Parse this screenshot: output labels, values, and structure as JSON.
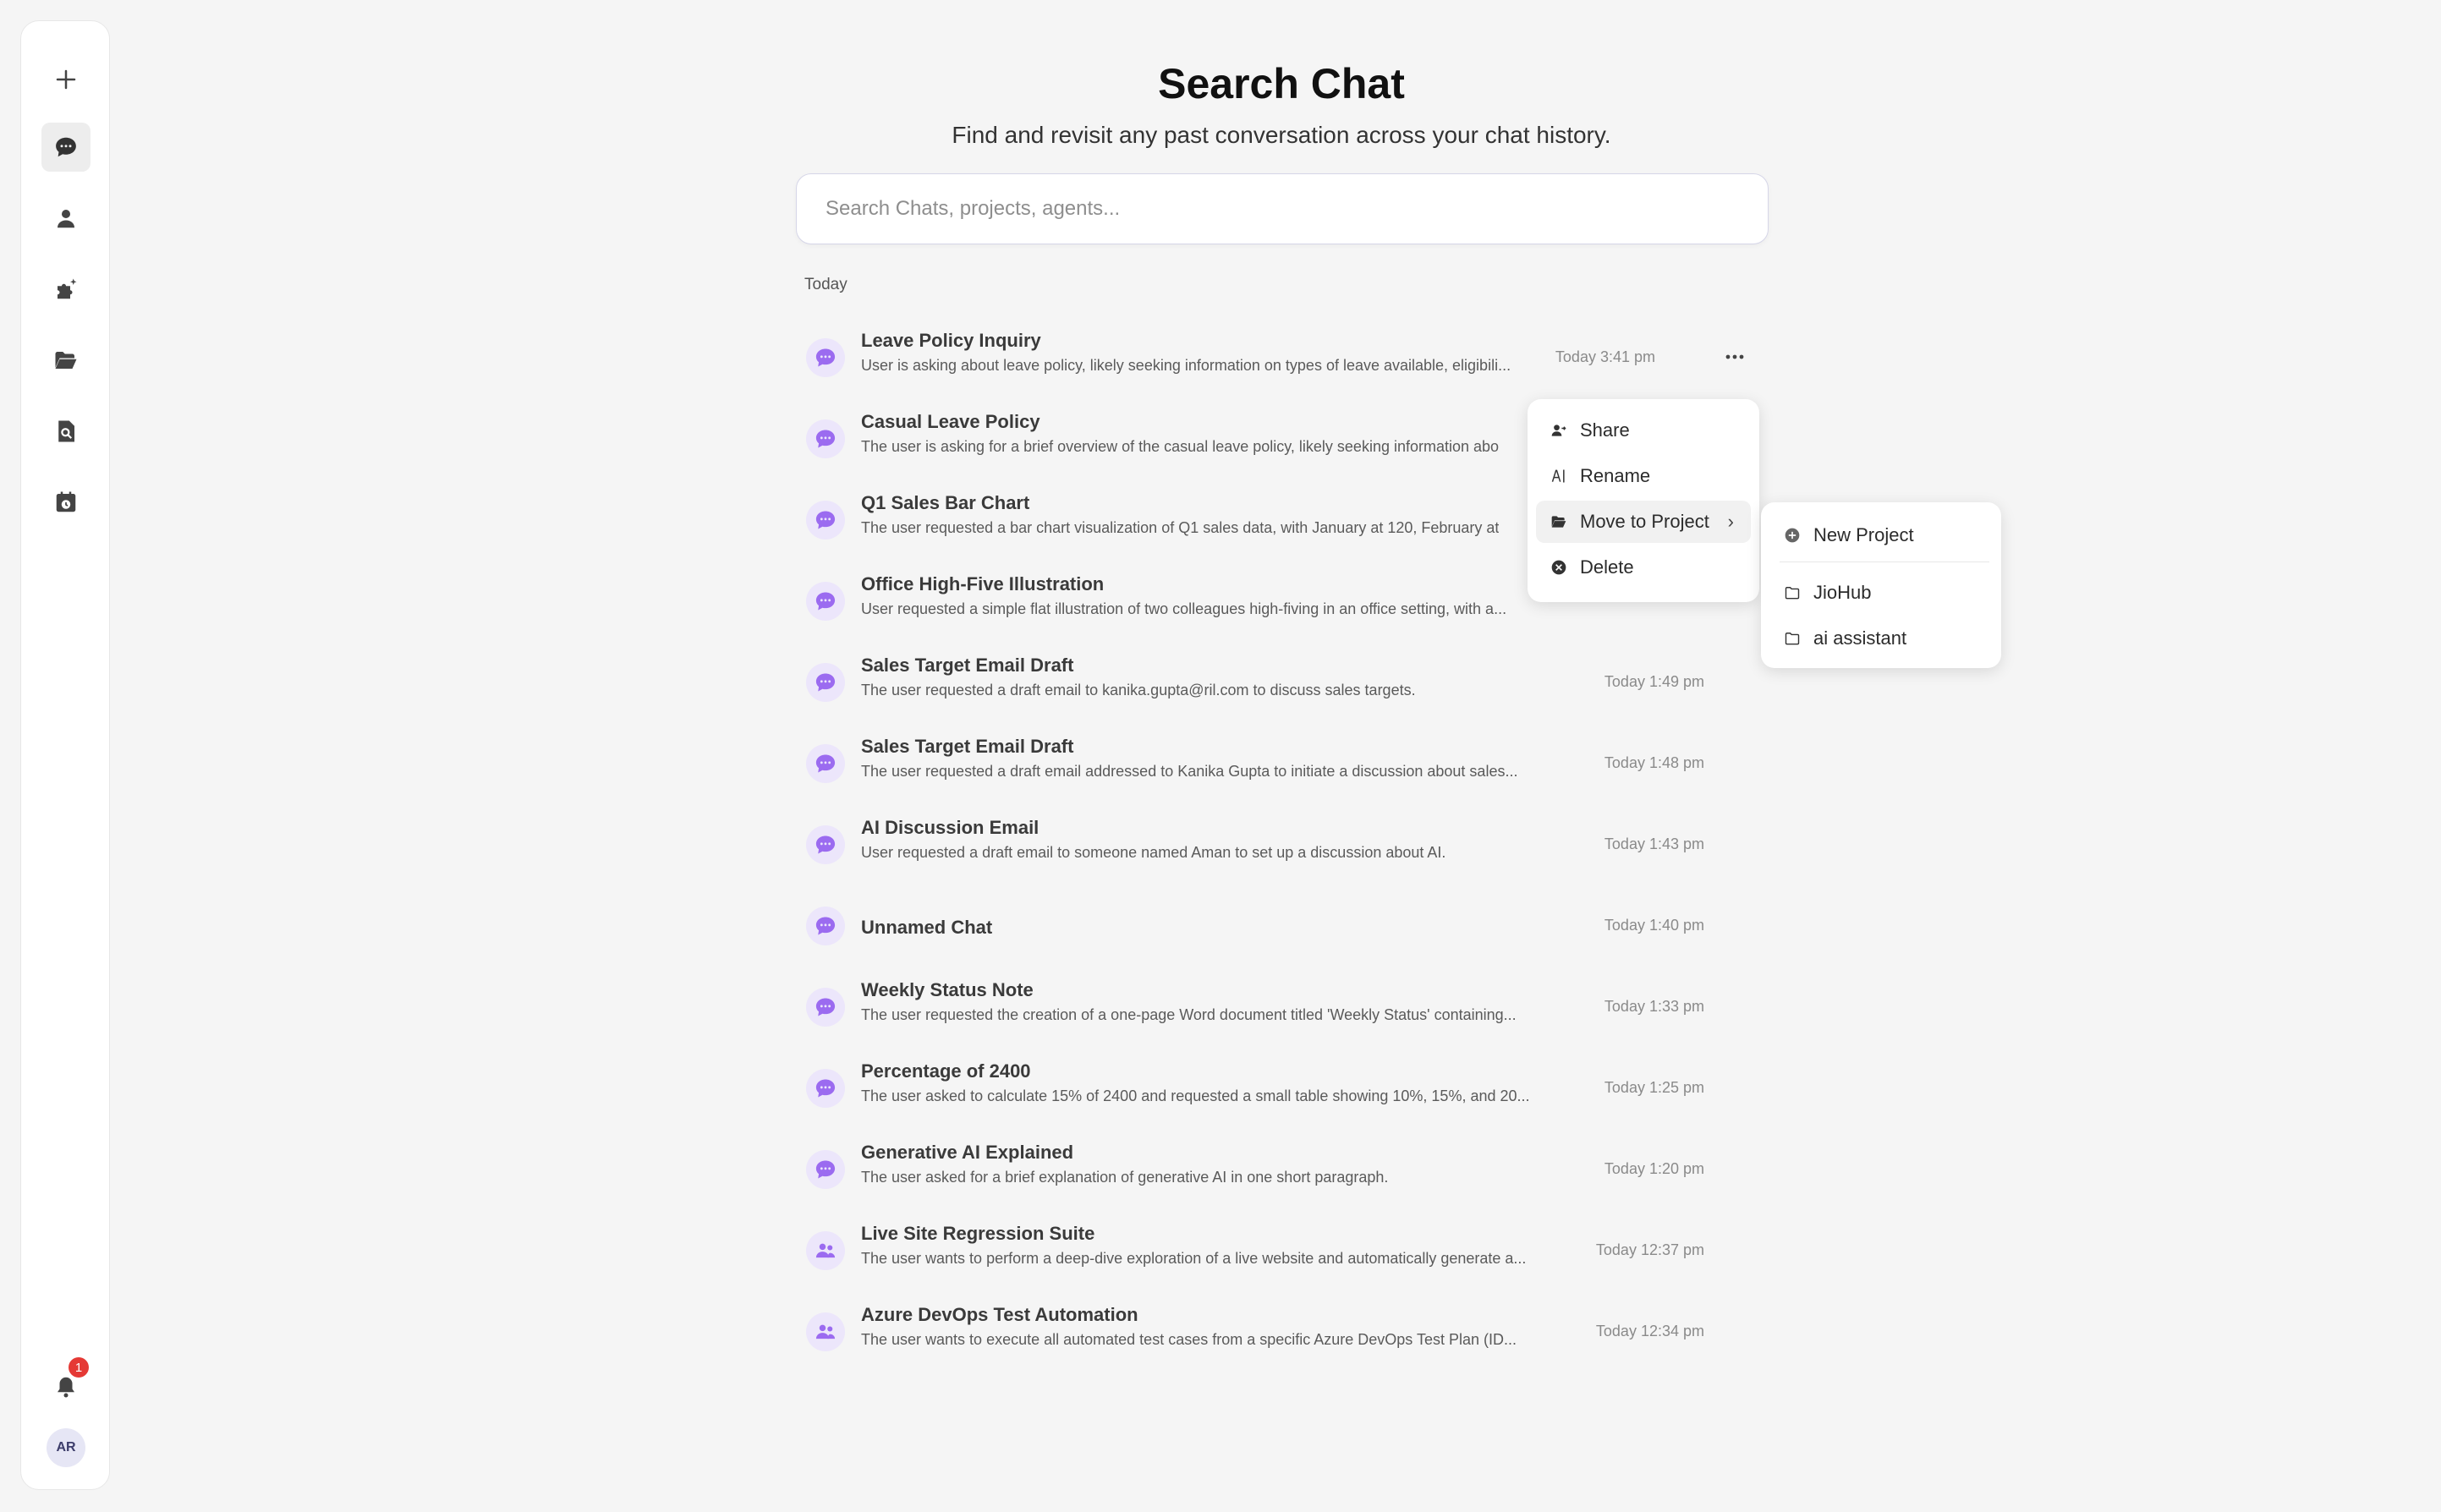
{
  "page": {
    "title": "Search Chat",
    "subtitle": "Find and revisit any past conversation across your chat history.",
    "search_placeholder": "Search Chats, projects, agents...",
    "section_label": "Today"
  },
  "sidebar": {
    "items": [
      {
        "name": "new-chat",
        "icon": "plus-icon"
      },
      {
        "name": "chats",
        "icon": "chat-bubble-icon",
        "active": true
      },
      {
        "name": "agents",
        "icon": "person-icon"
      },
      {
        "name": "plugins",
        "icon": "puzzle-sparkle-icon"
      },
      {
        "name": "projects",
        "icon": "folder-open-icon"
      },
      {
        "name": "file-search",
        "icon": "document-search-icon"
      },
      {
        "name": "scheduled",
        "icon": "calendar-clock-icon"
      }
    ],
    "notification_count": "1",
    "avatar_initials": "AR"
  },
  "chats": [
    {
      "title": "Leave Policy Inquiry",
      "desc": "User is asking about leave policy, likely seeking information on types of leave available, eligibili...",
      "time": "Today 3:41 pm",
      "icon": "chat-bubble-icon"
    },
    {
      "title": "Casual Leave Policy",
      "desc": "The user is asking for a brief overview of the casual leave policy, likely seeking information abo",
      "time": "",
      "icon": "chat-bubble-icon"
    },
    {
      "title": "Q1 Sales Bar Chart",
      "desc": "The user requested a bar chart visualization of Q1 sales data, with January at 120, February at",
      "time": "",
      "icon": "chat-bubble-icon"
    },
    {
      "title": "Office High-Five Illustration",
      "desc": "User requested a simple flat illustration of two colleagues high-fiving in an office setting, with a...",
      "time": "",
      "icon": "chat-bubble-icon"
    },
    {
      "title": "Sales Target Email Draft",
      "desc": "The user requested a draft email to kanika.gupta@ril.com to discuss sales targets.",
      "time": "Today 1:49 pm",
      "icon": "chat-bubble-icon"
    },
    {
      "title": "Sales Target Email Draft",
      "desc": "The user requested a draft email addressed to Kanika Gupta to initiate a discussion about sales...",
      "time": "Today 1:48 pm",
      "icon": "chat-bubble-icon"
    },
    {
      "title": "AI Discussion Email",
      "desc": "User requested a draft email to someone named Aman to set up a discussion about AI.",
      "time": "Today 1:43 pm",
      "icon": "chat-bubble-icon"
    },
    {
      "title": "Unnamed Chat",
      "desc": "",
      "time": "Today 1:40 pm",
      "icon": "chat-bubble-icon"
    },
    {
      "title": "Weekly Status Note",
      "desc": "The user requested the creation of a one-page Word document titled 'Weekly Status' containing...",
      "time": "Today 1:33 pm",
      "icon": "chat-bubble-icon"
    },
    {
      "title": "Percentage of 2400",
      "desc": "The user asked to calculate 15% of 2400 and requested a small table showing 10%, 15%, and 20...",
      "time": "Today 1:25 pm",
      "icon": "chat-bubble-icon"
    },
    {
      "title": "Generative AI Explained",
      "desc": "The user asked for a brief explanation of generative AI in one short paragraph.",
      "time": "Today 1:20 pm",
      "icon": "chat-bubble-icon"
    },
    {
      "title": "Live Site Regression Suite",
      "desc": "The user wants to perform a deep-dive exploration of a live website and automatically generate a...",
      "time": "Today 12:37 pm",
      "icon": "agent-group-icon"
    },
    {
      "title": "Azure DevOps Test Automation",
      "desc": "The user wants to execute all automated test cases from a specific Azure DevOps Test Plan (ID...",
      "time": "Today 12:34 pm",
      "icon": "agent-group-icon"
    }
  ],
  "context_menu": {
    "items": [
      {
        "label": "Share",
        "icon": "share-person-icon"
      },
      {
        "label": "Rename",
        "icon": "rename-icon"
      },
      {
        "label": "Move to Project",
        "icon": "folder-open-icon",
        "highlighted": true,
        "submenu": true
      },
      {
        "label": "Delete",
        "icon": "delete-circle-icon"
      }
    ]
  },
  "project_submenu": {
    "new_label": "New Project",
    "projects": [
      "JioHub",
      "ai assistant"
    ]
  },
  "colors": {
    "accent": "#8b5cf6",
    "icon_bg": "#ece6fb",
    "background": "#f5f5f5",
    "badge": "#e53935"
  }
}
